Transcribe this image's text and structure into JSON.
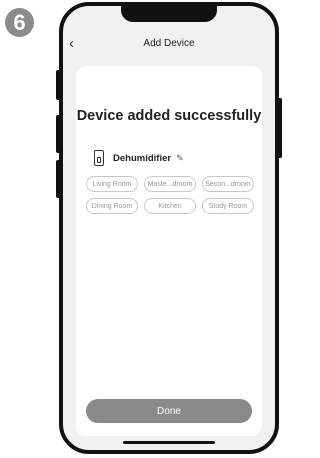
{
  "step": "6",
  "header": {
    "back_icon": "‹",
    "title": "Add Device"
  },
  "main": {
    "success_text": "Device added successfully",
    "device": {
      "icon": "dehumidifier-icon",
      "name": "Dehumidifier",
      "edit_icon": "✎"
    },
    "rooms": [
      "Living Room",
      "Maste...droom",
      "Secon...droom",
      "Dining Room",
      "Kitchen",
      "Study Room"
    ],
    "done_label": "Done"
  }
}
